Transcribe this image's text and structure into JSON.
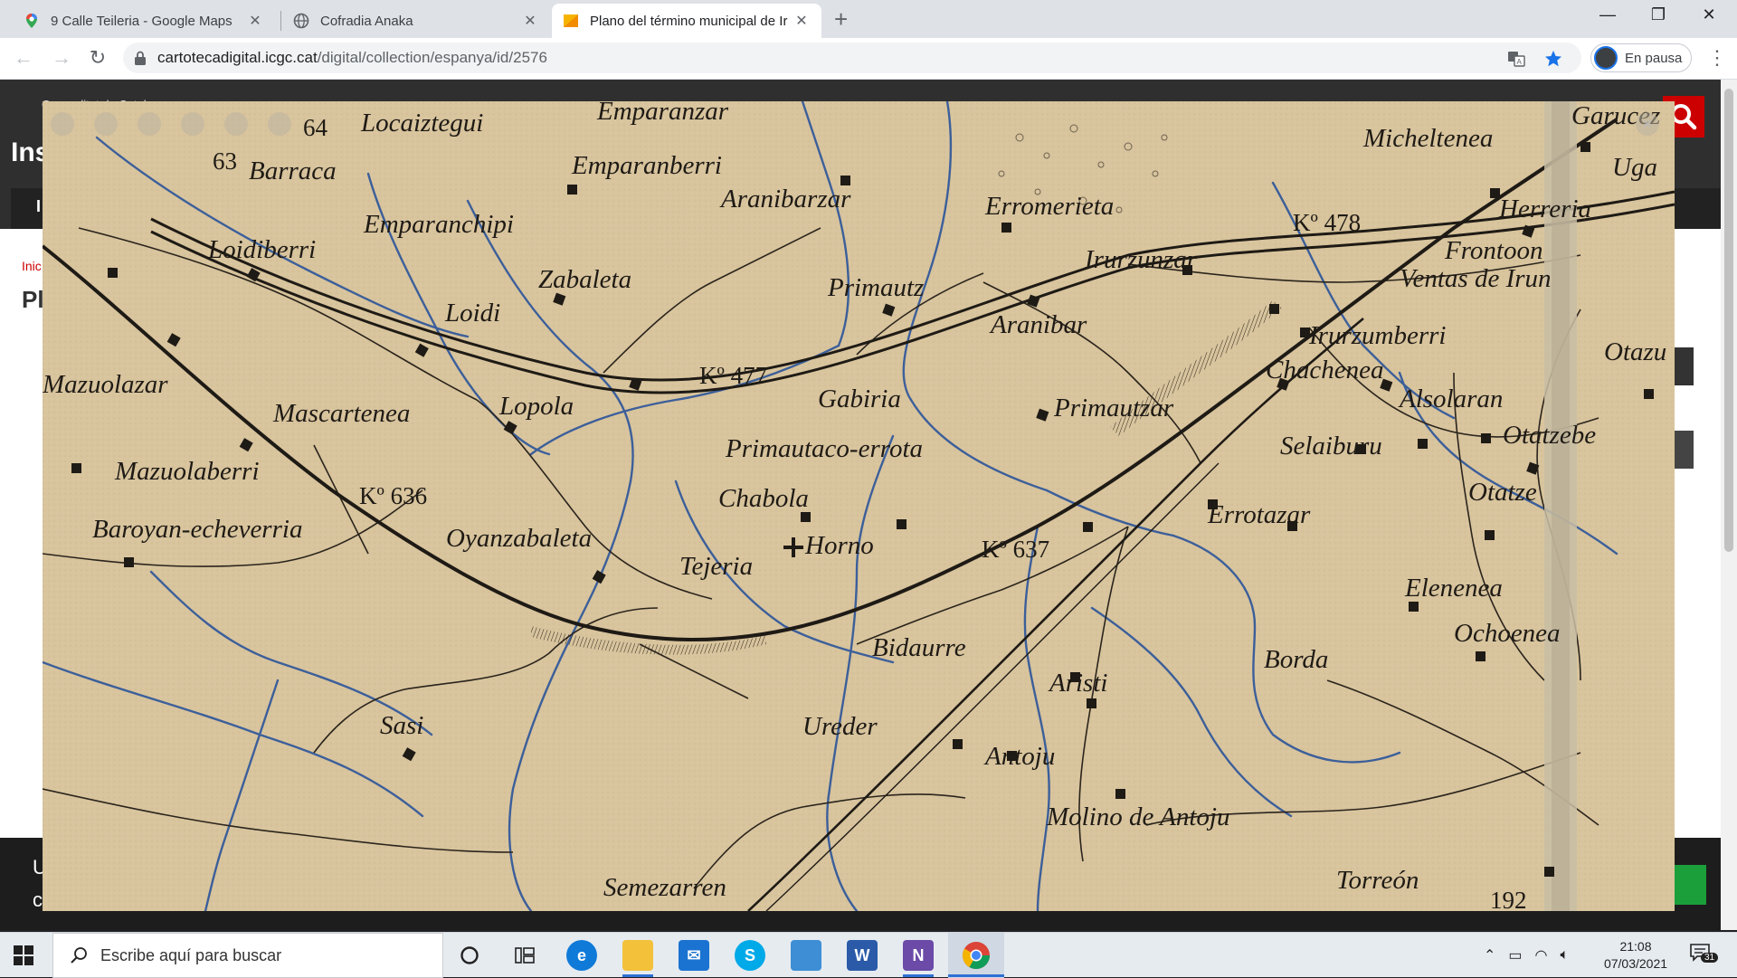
{
  "browser": {
    "tabs": [
      {
        "label": "9 Calle Teileria - Google Maps",
        "icon": "google-maps-icon",
        "active": false
      },
      {
        "label": "Cofradia Anaka",
        "icon": "globe-icon",
        "active": false
      },
      {
        "label": "Plano del término municipal de Ir",
        "icon": "cartoteca-icon",
        "active": true
      }
    ],
    "new_tab_label": "+",
    "url_host": "cartotecadigital.icgc.cat",
    "url_path": "/digital/collection/espanya/id/2576",
    "profile_label": "En pausa"
  },
  "page": {
    "header_brand": "Generalitat de Catalunya",
    "header_title_fragment": "Ins",
    "nav_fragment": "I",
    "breadcrumb_fragment": "Inic",
    "title_fragment": "Pl",
    "cookie_line1": "U",
    "cookie_line2": "c"
  },
  "map": {
    "place_names": [
      "Emparanzar",
      "Locaiztegui",
      "Barraca",
      "Emparanberri",
      "Aranibarzar",
      "Erromerieta",
      "Micheltenea",
      "Garucez",
      "Uga",
      "Herreria",
      "Frontoon",
      "Ventas de Irun",
      "Emparanchipi",
      "Loidiberri",
      "Zabaleta",
      "Loidi",
      "Primautz",
      "Irurzunzar",
      "Aranibar",
      "Irurzumberri",
      "Otazu",
      "Mazuolazar",
      "Mascartenea",
      "Lopola",
      "Gabiria",
      "Chachenea",
      "Alsolaran",
      "Primautzar",
      "Otatzebe",
      "Primautaco-errota",
      "Selaiburu",
      "Mazuolaberri",
      "Chabola",
      "Otatze",
      "Baroyan-echeverria",
      "Oyanzabaleta",
      "Horno",
      "Errotazar",
      "Tejeria",
      "Elenenea",
      "Ochoenea",
      "Bidaurre",
      "Borda",
      "Aristi",
      "Sasi",
      "Ureder",
      "Antoju",
      "Molino de Antoju",
      "Torreón",
      "Semezarren"
    ],
    "km_markers": [
      "Kº 477",
      "Kº 478",
      "Kº 636",
      "Kº 637"
    ],
    "numbers": [
      "64",
      "63",
      "192"
    ]
  },
  "taskbar": {
    "search_placeholder": "Escribe aquí para buscar",
    "time": "21:08",
    "date": "07/03/2021",
    "notification_count": "31"
  },
  "colors": {
    "map_paper": "#d7c39b",
    "map_ink": "#1e1a15",
    "river_blue": "#3c5f9a",
    "chrome_tab_bg": "#dee1e6"
  }
}
